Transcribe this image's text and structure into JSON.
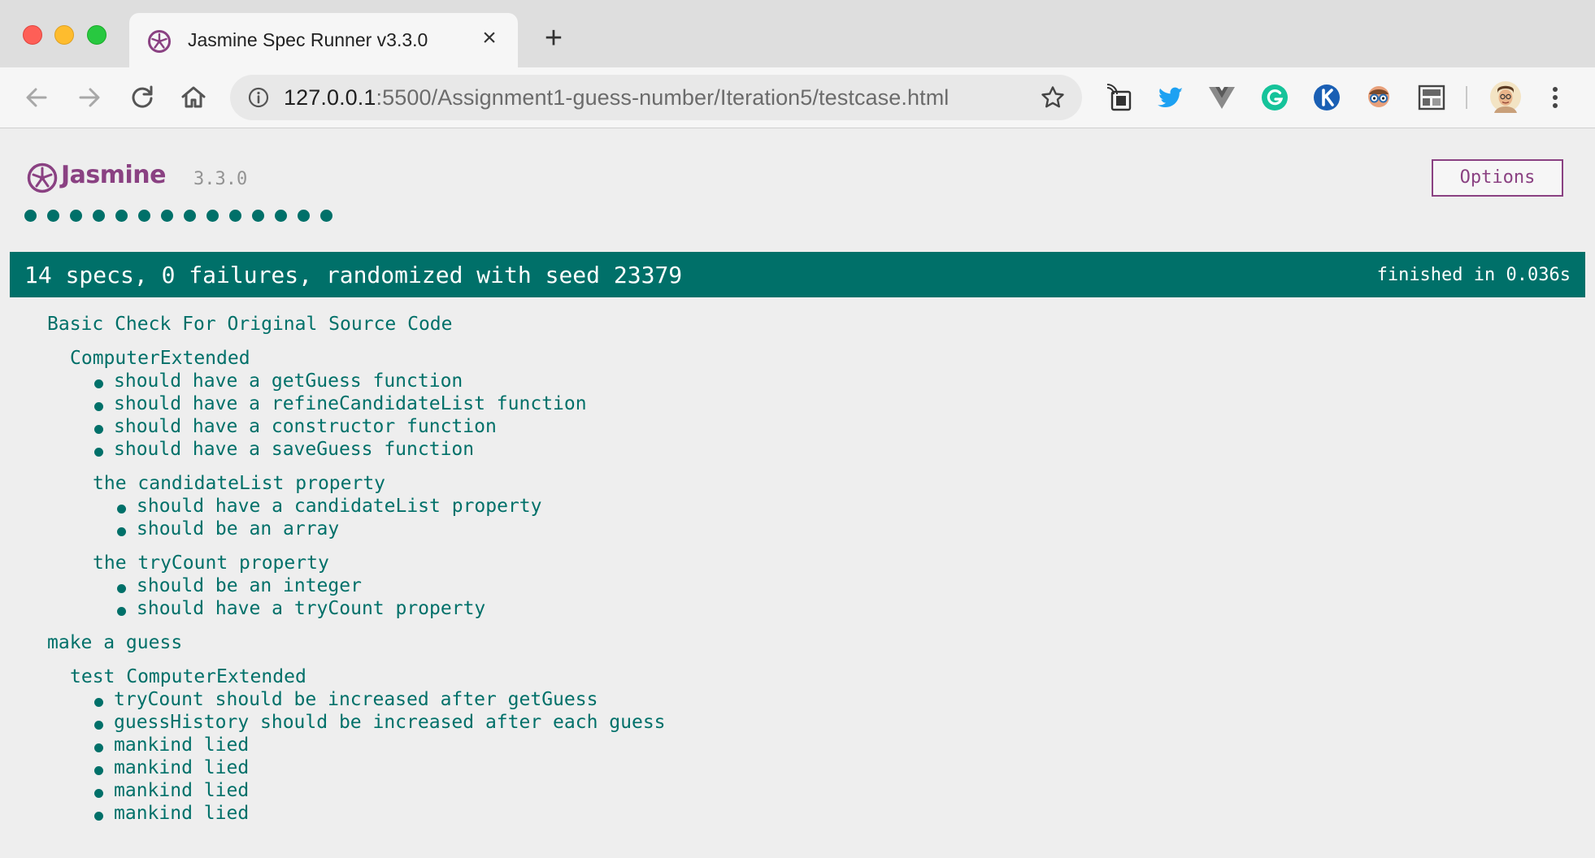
{
  "browser": {
    "tab_title": "Jasmine Spec Runner v3.3.0",
    "tab_close": "×",
    "new_tab": "+",
    "url_host": "127.0.0.1",
    "url_path": ":5500/Assignment1-guess-number/Iteration5/testcase.html",
    "extensions": [
      "cast-icon",
      "twitter-icon",
      "vue-devtools-icon",
      "grammarly-icon",
      "k-extension-icon",
      "glasses-extension-icon",
      "layout-extension-icon",
      "profile-avatar"
    ],
    "colors": {
      "twitter": "#1da1f2",
      "grammarly": "#15c39a",
      "k": "#1a5fb4"
    }
  },
  "jasmine": {
    "logo_text": "Jasmine",
    "version": "3.3.0",
    "options_label": "Options",
    "dot_count": 14,
    "summary": "14 specs, 0 failures, randomized with seed 23379",
    "duration": "finished in 0.036s",
    "colors": {
      "passed": "#007069",
      "brand": "#8a4182"
    }
  },
  "results": {
    "suite1": {
      "title": "Basic Check For Original Source Code",
      "child1": {
        "title": "ComputerExtended",
        "specs": [
          "should have a getGuess function",
          "should have a refineCandidateList function",
          "should have a constructor function",
          "should have a saveGuess function"
        ],
        "group1": {
          "title": "the candidateList property",
          "specs": [
            "should have a candidateList property",
            "should be an array"
          ]
        },
        "group2": {
          "title": "the tryCount property",
          "specs": [
            "should be an integer",
            "should have a tryCount property"
          ]
        }
      }
    },
    "suite2": {
      "title": "make a guess",
      "child1": {
        "title": "test ComputerExtended",
        "specs": [
          "tryCount should be increased after getGuess",
          "guessHistory should be increased after each guess",
          "mankind lied",
          "mankind lied",
          "mankind lied",
          "mankind lied"
        ]
      }
    }
  }
}
